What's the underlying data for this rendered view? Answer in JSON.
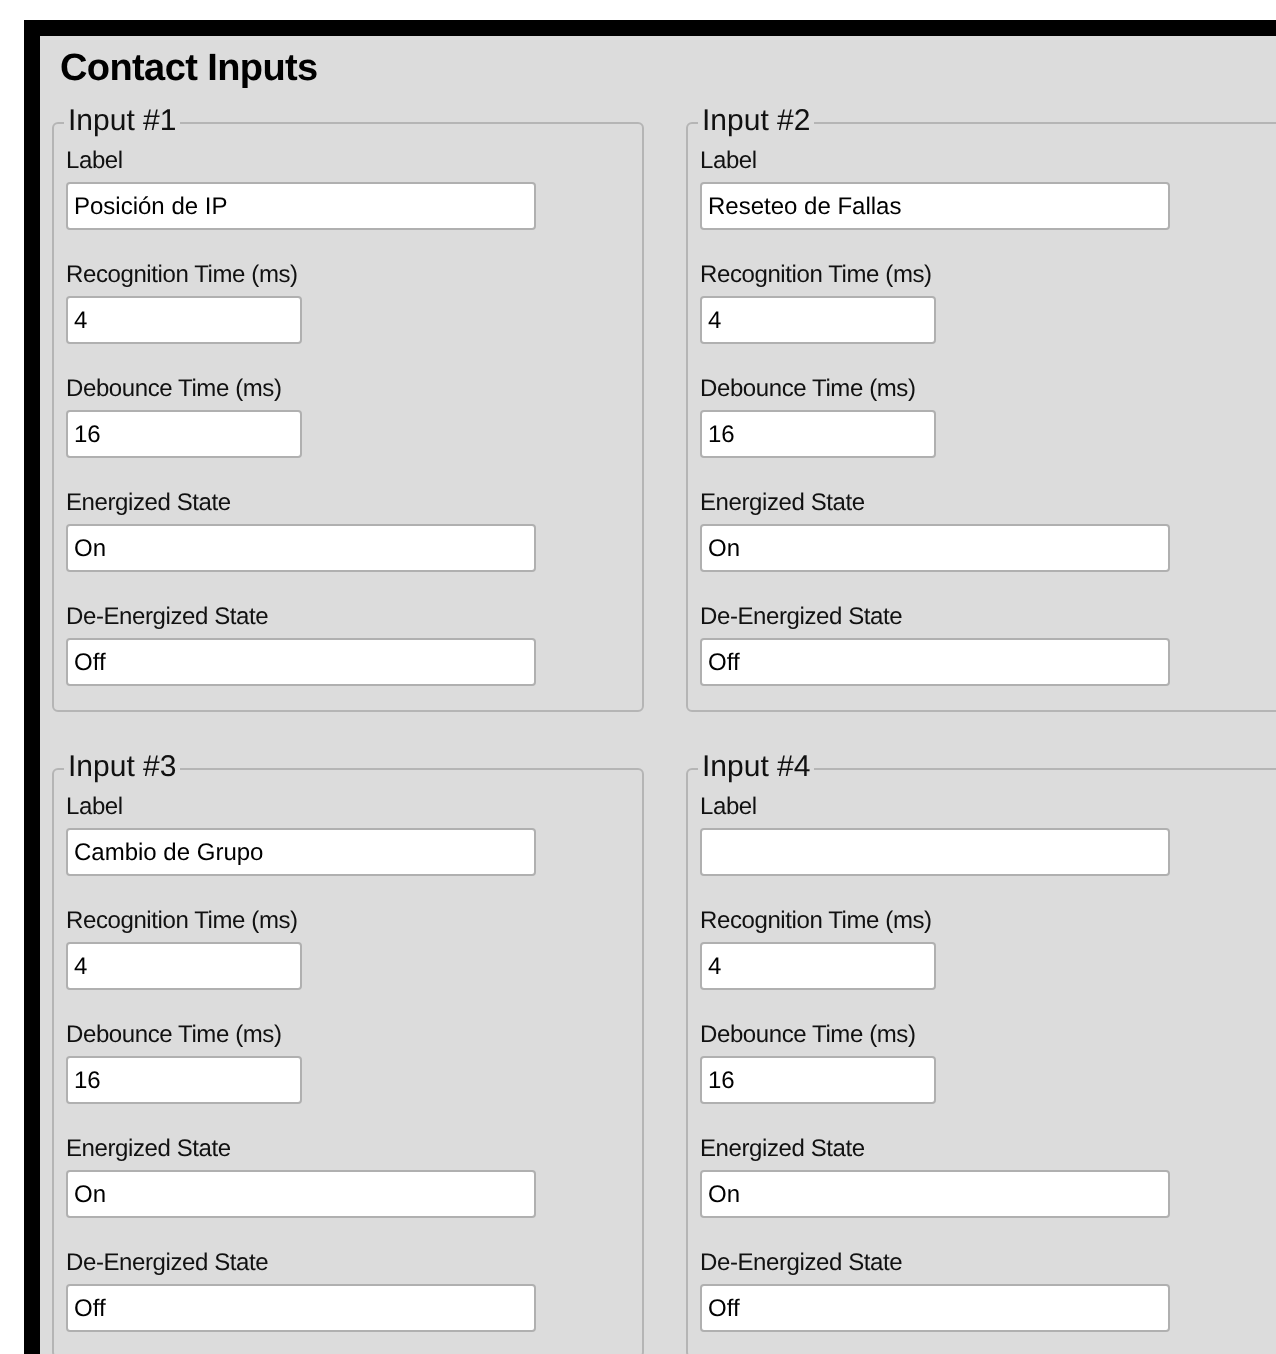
{
  "title": "Contact Inputs",
  "groups": [
    {
      "legend": "Input #1",
      "fields": [
        {
          "label": "Label",
          "kind": "wide",
          "value": "Posición de IP"
        },
        {
          "label": "Recognition Time (ms)",
          "kind": "narrow",
          "value": "4"
        },
        {
          "label": "Debounce Time (ms)",
          "kind": "narrow",
          "value": "16"
        },
        {
          "label": "Energized State",
          "kind": "wide",
          "value": "On"
        },
        {
          "label": "De-Energized State",
          "kind": "wide",
          "value": "Off"
        }
      ]
    },
    {
      "legend": "Input #2",
      "fields": [
        {
          "label": "Label",
          "kind": "wide",
          "value": "Reseteo de Fallas"
        },
        {
          "label": "Recognition Time (ms)",
          "kind": "narrow",
          "value": "4"
        },
        {
          "label": "Debounce Time (ms)",
          "kind": "narrow",
          "value": "16"
        },
        {
          "label": "Energized State",
          "kind": "wide",
          "value": "On"
        },
        {
          "label": "De-Energized State",
          "kind": "wide",
          "value": "Off"
        }
      ]
    },
    {
      "legend": "Input #3",
      "fields": [
        {
          "label": "Label",
          "kind": "wide",
          "value": "Cambio de Grupo"
        },
        {
          "label": "Recognition Time (ms)",
          "kind": "narrow",
          "value": "4"
        },
        {
          "label": "Debounce Time (ms)",
          "kind": "narrow",
          "value": "16"
        },
        {
          "label": "Energized State",
          "kind": "wide",
          "value": "On"
        },
        {
          "label": "De-Energized State",
          "kind": "wide",
          "value": "Off"
        }
      ]
    },
    {
      "legend": "Input #4",
      "fields": [
        {
          "label": "Label",
          "kind": "wide"
        },
        {
          "label": "Recognition Time (ms)",
          "kind": "narrow",
          "value": "4"
        },
        {
          "label": "Debounce Time (ms)",
          "kind": "narrow",
          "value": "16"
        },
        {
          "label": "Energized State",
          "kind": "wide",
          "value": "On"
        },
        {
          "label": "De-Energized State",
          "kind": "wide",
          "value": "Off"
        }
      ]
    }
  ]
}
